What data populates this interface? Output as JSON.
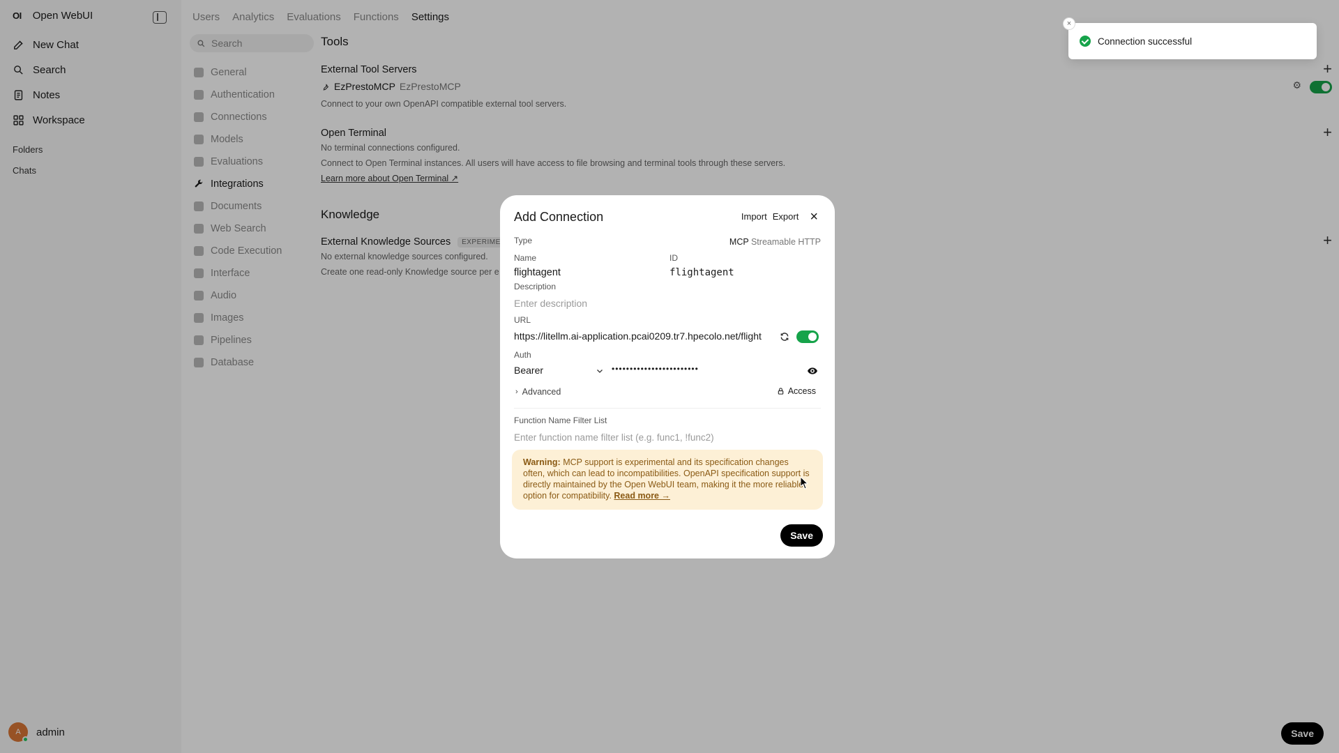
{
  "sidebar": {
    "logo": "OI",
    "app_name": "Open WebUI",
    "items": [
      {
        "label": "New Chat",
        "icon": "edit-icon"
      },
      {
        "label": "Search",
        "icon": "search-icon"
      },
      {
        "label": "Notes",
        "icon": "notes-icon"
      },
      {
        "label": "Workspace",
        "icon": "workspace-icon"
      }
    ],
    "folders_label": "Folders",
    "chats_label": "Chats",
    "user": {
      "initial": "A",
      "name": "admin"
    }
  },
  "topnav": {
    "tabs": [
      "Users",
      "Analytics",
      "Evaluations",
      "Functions",
      "Settings"
    ],
    "active": "Settings"
  },
  "settings_nav": {
    "search_placeholder": "Search",
    "items": [
      "General",
      "Authentication",
      "Connections",
      "Models",
      "Evaluations",
      "Integrations",
      "Documents",
      "Web Search",
      "Code Execution",
      "Interface",
      "Audio",
      "Images",
      "Pipelines",
      "Database"
    ],
    "active": "Integrations"
  },
  "content": {
    "tools_title": "Tools",
    "external_tool_servers": {
      "title": "External Tool Servers",
      "server_name": "EzPrestoMCP",
      "server_id": "EzPrestoMCP",
      "description": "Connect to your own OpenAPI compatible external tool servers."
    },
    "open_terminal": {
      "title": "Open Terminal",
      "status": "No terminal connections configured.",
      "description": "Connect to Open Terminal instances. All users will have access to file browsing and terminal tools through these servers.",
      "link": "Learn more about Open Terminal ↗"
    },
    "knowledge_title": "Knowledge",
    "external_knowledge": {
      "title": "External Knowledge Sources",
      "badge": "EXPERIMEN",
      "status": "No external knowledge sources configured.",
      "description": "Create one read-only Knowledge source per e"
    },
    "save_label": "Save"
  },
  "toast": {
    "message": "Connection successful",
    "close": "×"
  },
  "modal": {
    "title": "Add Connection",
    "import_label": "Import",
    "export_label": "Export",
    "type_label": "Type",
    "type_value": "MCP",
    "type_alt": "Streamable HTTP",
    "name_label": "Name",
    "name_value": "flightagent",
    "id_label": "ID",
    "id_value": "flightagent",
    "description_label": "Description",
    "description_placeholder": "Enter description",
    "url_label": "URL",
    "url_value": "https://litellm.ai-application.pcai0209.tr7.hpecolo.net/flight",
    "auth_label": "Auth",
    "auth_value": "Bearer",
    "auth_secret": "••••••••••••••••••••••••",
    "advanced_label": "Advanced",
    "access_label": "Access",
    "filter_label": "Function Name Filter List",
    "filter_placeholder": "Enter function name filter list (e.g. func1, !func2)",
    "warning_prefix": "Warning:",
    "warning_text": "MCP support is experimental and its specification changes often, which can lead to incompatibilities. OpenAPI specification support is directly maintained by the Open WebUI team, making it the more reliable option for compatibility.",
    "warning_link": "Read more →",
    "save_label": "Save"
  }
}
